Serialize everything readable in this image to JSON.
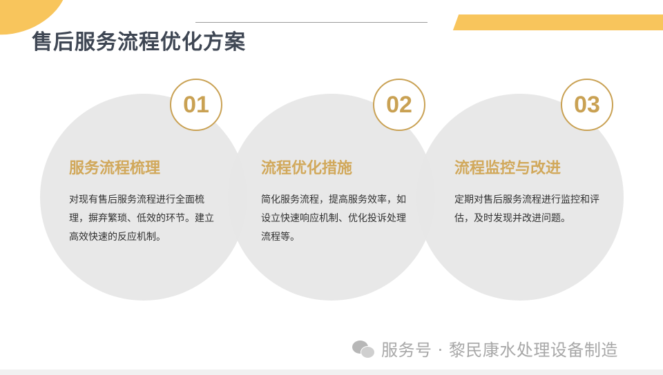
{
  "slide": {
    "title": "售后服务流程优化方案"
  },
  "steps": [
    {
      "number": "01",
      "title": "服务流程梳理",
      "description": "对现有售后服务流程进行全面梳理，摒弃繁琐、低效的环节。建立高效快速的反应机制。"
    },
    {
      "number": "02",
      "title": "流程优化措施",
      "description": "简化服务流程，提高服务效率，如设立快速响应机制、优化投诉处理流程等。"
    },
    {
      "number": "03",
      "title": "流程监控与改进",
      "description": "定期对售后服务流程进行监控和评估，及时发现并改进问题。"
    }
  ],
  "watermark": {
    "icon": "wechat-icon",
    "text": "服务号 · 黎民康水处理设备制造"
  },
  "colors": {
    "accent_yellow": "#f8c55c",
    "gold": "#c9a153",
    "step_title": "#d1a85a",
    "title_text": "#3e4653",
    "circle_fill": "#e6e6e6"
  }
}
